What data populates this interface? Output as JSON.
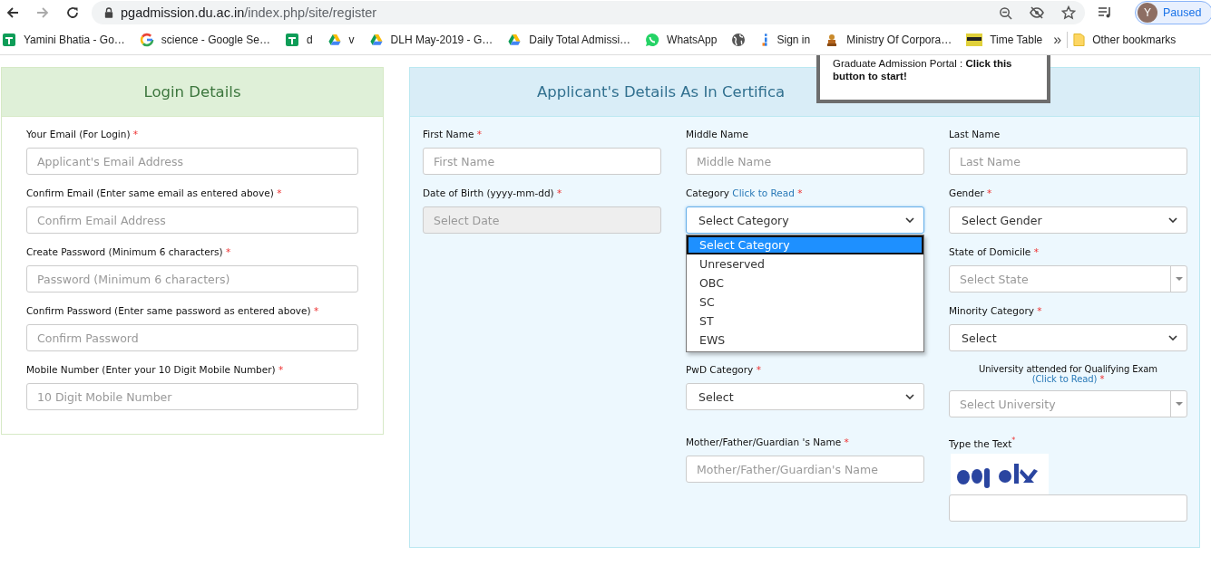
{
  "browser": {
    "url_host": "pgadmission.du.ac.in",
    "url_path": "/index.php/site/register",
    "profile": {
      "initial": "Y",
      "status": "Paused"
    }
  },
  "bookmarks": [
    {
      "kind": "sheets",
      "label": "Yamini Bhatia - Go…"
    },
    {
      "kind": "google",
      "label": "science - Google Se…"
    },
    {
      "kind": "sheets",
      "label": "d"
    },
    {
      "kind": "drive",
      "label": "v"
    },
    {
      "kind": "drive",
      "label": "DLH May-2019 - G…"
    },
    {
      "kind": "drive",
      "label": "Daily Total Admissi…"
    },
    {
      "kind": "whatsapp",
      "label": "WhatsApp"
    },
    {
      "kind": "globe"
    },
    {
      "kind": "signin",
      "label": "Sign in"
    },
    {
      "kind": "emblem",
      "label": "Ministry Of Corpora…"
    },
    {
      "kind": "tile",
      "label": "Time Table"
    }
  ],
  "bookmarks_overflow": "»",
  "other_bookmarks": "Other bookmarks",
  "login": {
    "title": "Login Details",
    "fields": [
      {
        "label": "Your Email (For Login)",
        "mark": "*",
        "placeholder": "Applicant's Email Address"
      },
      {
        "label": "Confirm Email (Enter same email as entered above)",
        "mark": "*",
        "placeholder": "Confirm Email Address"
      },
      {
        "label": "Create Password (Minimum 6 characters)",
        "mark": "*",
        "placeholder": "Password (Minimum 6 characters)"
      },
      {
        "label": "Confirm Password (Enter same password as entered above)",
        "mark": "*",
        "placeholder": "Confirm Password"
      },
      {
        "label": "Mobile Number (Enter your 10 Digit Mobile Number)",
        "mark": "*",
        "placeholder": "10 Digit Mobile Number"
      }
    ]
  },
  "applicant": {
    "title": "Applicant's Details As In Certifica",
    "columns": [
      [
        {
          "kind": "text",
          "label": "First Name",
          "mark": "*",
          "placeholder": "First Name"
        },
        {
          "kind": "text",
          "label": "Date of Birth (yyyy-mm-dd)",
          "mark": "*",
          "placeholder": "Select Date",
          "disabled": true
        }
      ],
      [
        {
          "kind": "text",
          "label": "Middle Name",
          "placeholder": "Middle Name"
        },
        {
          "kind": "select",
          "label": "Category",
          "link": "Click to Read",
          "mark": "*",
          "value": "Select Category",
          "focused": true,
          "options": [
            {
              "label": "Select Category",
              "selected": true
            },
            {
              "label": "Unreserved",
              "selected": false
            },
            {
              "label": "OBC",
              "selected": false
            },
            {
              "label": "SC",
              "selected": false
            },
            {
              "label": "ST",
              "selected": false
            },
            {
              "label": "EWS",
              "selected": false
            }
          ]
        },
        {
          "kind": "select",
          "label": "PwD Category",
          "mark": "*",
          "value": "Select",
          "focused": false
        },
        {
          "kind": "text",
          "label": "Mother/Father/Guardian 's Name",
          "mark": "*",
          "placeholder": "Mother/Father/Guardian's Name"
        }
      ],
      [
        {
          "kind": "text",
          "label": "Last Name",
          "placeholder": "Last Name"
        },
        {
          "kind": "select",
          "label": "Gender",
          "mark": "*",
          "value": "Select Gender",
          "focused": false
        },
        {
          "kind": "combo",
          "label": "State of Domicile",
          "mark": "*",
          "placeholder": "Select State"
        },
        {
          "kind": "select",
          "label": "Minority Category",
          "mark": "*",
          "value": "Select",
          "focused": false
        },
        {
          "kind": "combo",
          "label": "University attended for Qualifying Exam",
          "link": "(Click to Read)",
          "mark": "*",
          "placeholder": "Select University"
        },
        {
          "kind": "captcha",
          "label": "Type the Text",
          "mark": "*"
        }
      ]
    ]
  },
  "popup": {
    "text": "Graduate Admission Portal : **Click this button to start!**"
  }
}
